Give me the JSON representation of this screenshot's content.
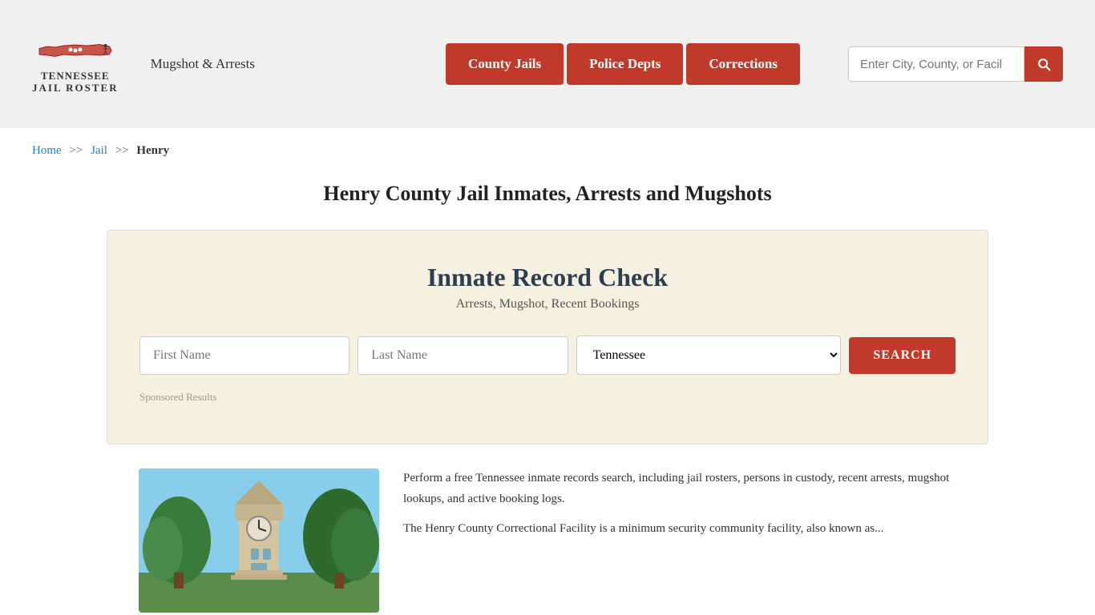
{
  "header": {
    "logo": {
      "line1": "TENNESSEE",
      "line2": "JAIL ROSTER",
      "alt": "Tennessee Jail Roster"
    },
    "mugshot_link": "Mugshot & Arrests",
    "nav_buttons": [
      {
        "id": "county-jails",
        "label": "County Jails"
      },
      {
        "id": "police-depts",
        "label": "Police Depts"
      },
      {
        "id": "corrections",
        "label": "Corrections"
      }
    ],
    "search_placeholder": "Enter City, County, or Facil"
  },
  "breadcrumb": {
    "items": [
      {
        "label": "Home",
        "href": "#"
      },
      {
        "label": "Jail",
        "href": "#"
      },
      {
        "label": "Henry",
        "href": null
      }
    ],
    "separator": ">>"
  },
  "page_title": "Henry County Jail Inmates, Arrests and Mugshots",
  "record_check": {
    "title": "Inmate Record Check",
    "subtitle": "Arrests, Mugshot, Recent Bookings",
    "first_name_placeholder": "First Name",
    "last_name_placeholder": "Last Name",
    "state_default": "Tennessee",
    "search_button": "SEARCH",
    "sponsored_label": "Sponsored Results"
  },
  "content": {
    "paragraph1": "Perform a free Tennessee inmate records search, including jail rosters, persons in custody, recent arrests, mugshot lookups, and active booking logs.",
    "paragraph2": "The Henry County Correctional Facility is a minimum security community facility, also known as..."
  }
}
